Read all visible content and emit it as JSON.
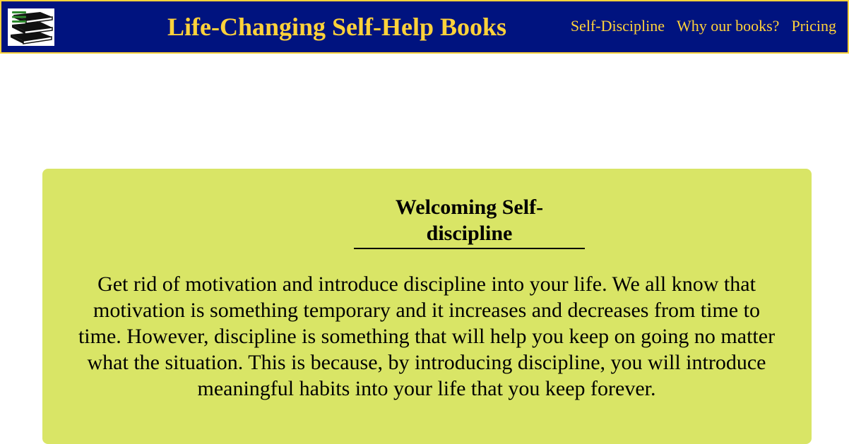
{
  "header": {
    "logo_icon": "books-stack-logo",
    "menu_icon": "hamburger-menu-icon",
    "title": "Life-Changing Self-Help Books",
    "nav": [
      {
        "label": "Self-Discipline"
      },
      {
        "label": "Why our books?"
      },
      {
        "label": "Pricing"
      }
    ]
  },
  "card": {
    "heading_line1": "Welcoming Self-",
    "heading_line2": "discipline",
    "text": "Get rid of motivation and introduce discipline into your life. We all know that motivation is something temporary and it increases and decreases from time to time. However, discipline is something that will help you keep on going no matter what the situation. This is because, by introducing discipline, you will introduce meaningful habits into your life that you keep forever."
  },
  "colors": {
    "header_bg": "#00137f",
    "accent": "#ffd23a",
    "card_bg": "#d9e566"
  }
}
